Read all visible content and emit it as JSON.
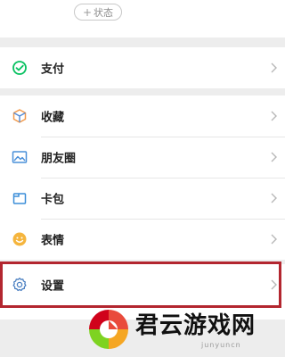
{
  "profile": {
    "status_plus": "+",
    "status_label": "状态"
  },
  "menu": {
    "pay": {
      "label": "支付",
      "icon": "wechat-pay-icon"
    },
    "favorites": {
      "label": "收藏",
      "icon": "favorites-cube-icon"
    },
    "moments": {
      "label": "朋友圈",
      "icon": "moments-picture-icon"
    },
    "cards": {
      "label": "卡包",
      "icon": "card-wallet-icon"
    },
    "stickers": {
      "label": "表情",
      "icon": "sticker-smiley-icon"
    },
    "settings": {
      "label": "设置",
      "icon": "settings-gear-icon"
    }
  },
  "watermark": {
    "title": "君云游戏网",
    "subtitle": "junyuncn"
  },
  "colors": {
    "background": "#ededed",
    "highlight": "#b3262f",
    "pay_green": "#07c160",
    "favorites_orange": "#f2994a",
    "moments_blue": "#4a90d9",
    "cards_blue": "#3b8ed8",
    "stickers_yellow": "#f5b53d",
    "settings_blue": "#4a7fc1"
  }
}
